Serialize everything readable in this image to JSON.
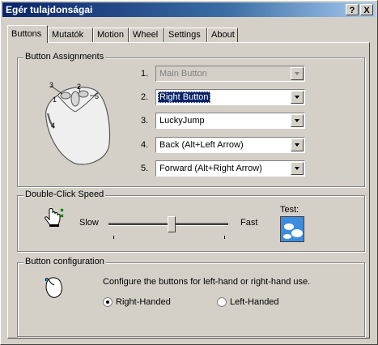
{
  "window": {
    "title": "Egér tulajdonságai",
    "help_btn": "?",
    "close_btn": "X"
  },
  "tabs": [
    "Buttons",
    "Mutatók",
    "Motion",
    "Wheel",
    "Settings",
    "About"
  ],
  "button_assignments": {
    "title": "Button Assignments",
    "mouse_labels": [
      "1",
      "2",
      "3",
      "4",
      "5"
    ],
    "rows": [
      {
        "num": "1.",
        "value": "Main Button"
      },
      {
        "num": "2.",
        "value": "Right Button"
      },
      {
        "num": "3.",
        "value": "LuckyJump"
      },
      {
        "num": "4.",
        "value": "Back (Alt+Left Arrow)"
      },
      {
        "num": "5.",
        "value": "Forward (Alt+Right Arrow)"
      }
    ]
  },
  "double_click": {
    "title": "Double-Click Speed",
    "slow": "Slow",
    "fast": "Fast",
    "test": "Test:",
    "level": 0.53
  },
  "button_config": {
    "title": "Button configuration",
    "description": "Configure the buttons for left-hand or right-hand use.",
    "right_handed": "Right-Handed",
    "left_handed": "Left-Handed",
    "selected": "right"
  }
}
